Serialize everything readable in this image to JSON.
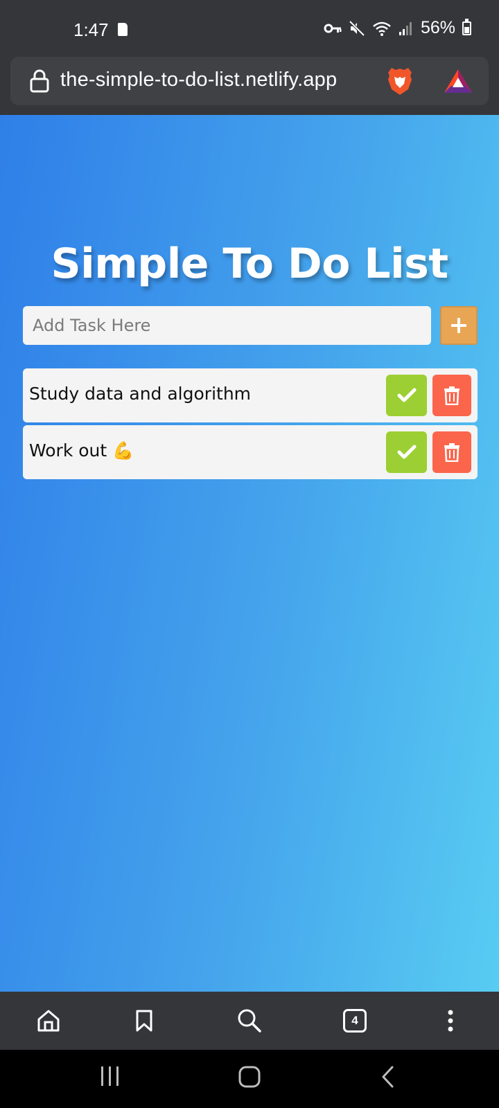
{
  "status_bar": {
    "time": "1:47",
    "battery": "56%"
  },
  "browser": {
    "url": "the-simple-to-do-list.netlify.app",
    "tab_count": "4"
  },
  "app": {
    "title": "Simple To Do List",
    "input_placeholder": "Add Task Here",
    "add_label": "+",
    "tasks": [
      {
        "text": "Study data and algorithm"
      },
      {
        "text": "Work out 💪"
      }
    ]
  },
  "colors": {
    "gradient_start": "#2f7fe8",
    "gradient_end": "#58ccf2",
    "add_button": "#e8a654",
    "done_button": "#9ccf33",
    "delete_button": "#fb654c",
    "chrome_bg": "#35363a"
  },
  "icons": {
    "status": [
      "sd-card-icon",
      "key-icon",
      "mute-icon",
      "wifi-icon",
      "signal-icon",
      "battery-icon"
    ],
    "url_bar": [
      "lock-icon",
      "brave-lion-icon",
      "bat-rewards-icon"
    ],
    "toolbar": [
      "home-icon",
      "bookmark-icon",
      "search-icon",
      "tabs-icon",
      "more-menu-icon"
    ],
    "nav": [
      "recents-icon",
      "home-nav-icon",
      "back-icon"
    ]
  }
}
